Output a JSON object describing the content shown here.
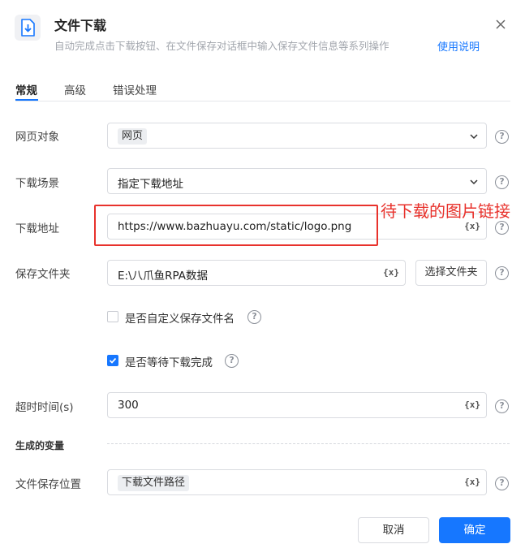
{
  "header": {
    "title": "文件下载",
    "subtitle": "自动完成点击下载按钮、在文件保存对话框中输入保存文件信息等系列操作",
    "help_link": "使用说明",
    "icon": "download-file-icon"
  },
  "tabs": [
    {
      "label": "常规",
      "active": true
    },
    {
      "label": "高级",
      "active": false
    },
    {
      "label": "错误处理",
      "active": false
    }
  ],
  "form": {
    "webpage": {
      "label": "网页对象",
      "value": "网页"
    },
    "scene": {
      "label": "下载场景",
      "value": "指定下载地址"
    },
    "url": {
      "label": "下载地址",
      "value": "https://www.bazhuayu.com/static/logo.png"
    },
    "folder": {
      "label": "保存文件夹",
      "value": "E:\\八爪鱼RPA数据",
      "button": "选择文件夹"
    },
    "custom_name": {
      "label": "是否自定义保存文件名",
      "checked": false
    },
    "wait_done": {
      "label": "是否等待下载完成",
      "checked": true
    },
    "timeout": {
      "label": "超时时间(s)",
      "value": "300"
    }
  },
  "variables": {
    "section_title": "生成的变量",
    "file_path": {
      "label": "文件保存位置",
      "value": "下载文件路径"
    }
  },
  "var_button": "{x}",
  "help_glyph": "?",
  "annotation": {
    "text": "待下载的图片链接",
    "color": "#e8322c"
  },
  "footer": {
    "cancel": "取消",
    "ok": "确定"
  },
  "colors": {
    "accent": "#1677ff",
    "annotation": "#e8322c"
  }
}
